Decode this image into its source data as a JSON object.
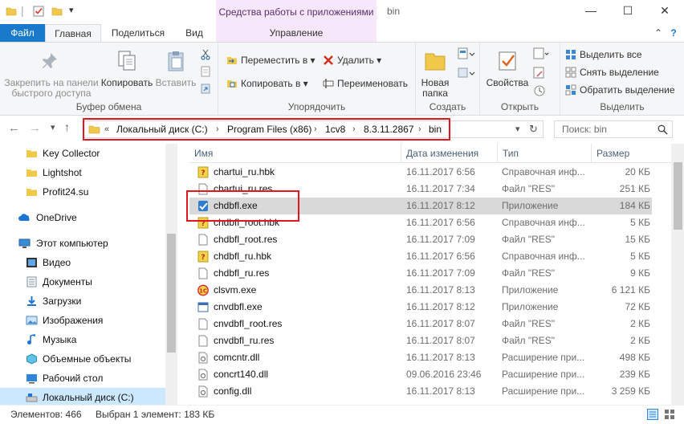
{
  "titlebar": {
    "context_tab_label": "Средства работы с приложениями",
    "window_title": "bin",
    "minimize_glyph": "—",
    "maximize_glyph": "☐",
    "close_glyph": "✕"
  },
  "tabs": {
    "file": "Файл",
    "home": "Главная",
    "share": "Поделиться",
    "view": "Вид",
    "manage": "Управление",
    "collapse_glyph": "⌃",
    "help_glyph": "?"
  },
  "ribbon": {
    "clipboard": {
      "group_label": "Буфер обмена",
      "pin_line1": "Закрепить на панели",
      "pin_line2": "быстрого доступа",
      "copy": "Копировать",
      "paste": "Вставить"
    },
    "organize": {
      "group_label": "Упорядочить",
      "move_to": "Переместить в ▾",
      "copy_to": "Копировать в ▾",
      "delete": "Удалить ▾",
      "rename": "Переименовать"
    },
    "new": {
      "group_label": "Создать",
      "new_folder_line1": "Новая",
      "new_folder_line2": "папка"
    },
    "open": {
      "group_label": "Открыть",
      "properties": "Свойства"
    },
    "select": {
      "group_label": "Выделить",
      "select_all": "Выделить все",
      "select_none": "Снять выделение",
      "invert": "Обратить выделение"
    }
  },
  "address": {
    "overflow": "«",
    "crumbs": [
      "Локальный диск (C:)",
      "Program Files (x86)",
      "1cv8",
      "8.3.11.2867",
      "bin"
    ],
    "search_placeholder": "Поиск: bin"
  },
  "nav": {
    "items": [
      {
        "label": "Key Collector",
        "icon": "folder-icon"
      },
      {
        "label": "Lightshot",
        "icon": "folder-icon"
      },
      {
        "label": "Profit24.su",
        "icon": "folder-icon"
      },
      {
        "label": "OneDrive",
        "icon": "cloud-icon"
      },
      {
        "label": "Этот компьютер",
        "icon": "computer-icon"
      },
      {
        "label": "Видео",
        "icon": "video-folder-icon"
      },
      {
        "label": "Документы",
        "icon": "documents-folder-icon"
      },
      {
        "label": "Загрузки",
        "icon": "downloads-folder-icon"
      },
      {
        "label": "Изображения",
        "icon": "pictures-folder-icon"
      },
      {
        "label": "Музыка",
        "icon": "music-folder-icon"
      },
      {
        "label": "Объемные объекты",
        "icon": "3d-objects-icon"
      },
      {
        "label": "Рабочий стол",
        "icon": "desktop-folder-icon"
      },
      {
        "label": "Локальный диск (C:)",
        "icon": "drive-icon"
      }
    ]
  },
  "list": {
    "columns": {
      "name": "Имя",
      "date": "Дата изменения",
      "type": "Тип",
      "size": "Размер"
    },
    "rows": [
      {
        "name": "chartui_ru.hbk",
        "date": "16.11.2017 6:56",
        "type": "Справочная инф...",
        "size": "20 КБ",
        "icon": "help-file-icon"
      },
      {
        "name": "chartui_ru.res",
        "date": "16.11.2017 7:34",
        "type": "Файл \"RES\"",
        "size": "251 КБ",
        "icon": "file-icon"
      },
      {
        "name": "chdbfl.exe",
        "date": "16.11.2017 8:12",
        "type": "Приложение",
        "size": "184 КБ",
        "icon": "app-icon"
      },
      {
        "name": "chdbfl_root.hbk",
        "date": "16.11.2017 6:56",
        "type": "Справочная инф...",
        "size": "5 КБ",
        "icon": "help-file-icon"
      },
      {
        "name": "chdbfl_root.res",
        "date": "16.11.2017 7:09",
        "type": "Файл \"RES\"",
        "size": "15 КБ",
        "icon": "file-icon"
      },
      {
        "name": "chdbfl_ru.hbk",
        "date": "16.11.2017 6:56",
        "type": "Справочная инф...",
        "size": "5 КБ",
        "icon": "help-file-icon"
      },
      {
        "name": "chdbfl_ru.res",
        "date": "16.11.2017 7:09",
        "type": "Файл \"RES\"",
        "size": "9 КБ",
        "icon": "file-icon"
      },
      {
        "name": "clsvm.exe",
        "date": "16.11.2017 8:13",
        "type": "Приложение",
        "size": "6 121 КБ",
        "icon": "1c-app-icon"
      },
      {
        "name": "cnvdbfl.exe",
        "date": "16.11.2017 8:12",
        "type": "Приложение",
        "size": "72 КБ",
        "icon": "window-app-icon"
      },
      {
        "name": "cnvdbfl_root.res",
        "date": "16.11.2017 8:07",
        "type": "Файл \"RES\"",
        "size": "2 КБ",
        "icon": "file-icon"
      },
      {
        "name": "cnvdbfl_ru.res",
        "date": "16.11.2017 8:07",
        "type": "Файл \"RES\"",
        "size": "2 КБ",
        "icon": "file-icon"
      },
      {
        "name": "comcntr.dll",
        "date": "16.11.2017 8:13",
        "type": "Расширение при...",
        "size": "498 КБ",
        "icon": "dll-icon"
      },
      {
        "name": "concrt140.dll",
        "date": "09.06.2016 23:46",
        "type": "Расширение при...",
        "size": "239 КБ",
        "icon": "dll-icon"
      },
      {
        "name": "config.dll",
        "date": "16.11.2017 8:13",
        "type": "Расширение при...",
        "size": "3 259 КБ",
        "icon": "dll-icon"
      }
    ]
  },
  "status": {
    "count": "Элементов: 466",
    "selected": "Выбран 1 элемент: 183 КБ"
  },
  "colors": {
    "accent": "#1979ca",
    "highlight": "#e1161e",
    "selection": "#cce8ff",
    "row_selected": "#d9d9d9"
  }
}
